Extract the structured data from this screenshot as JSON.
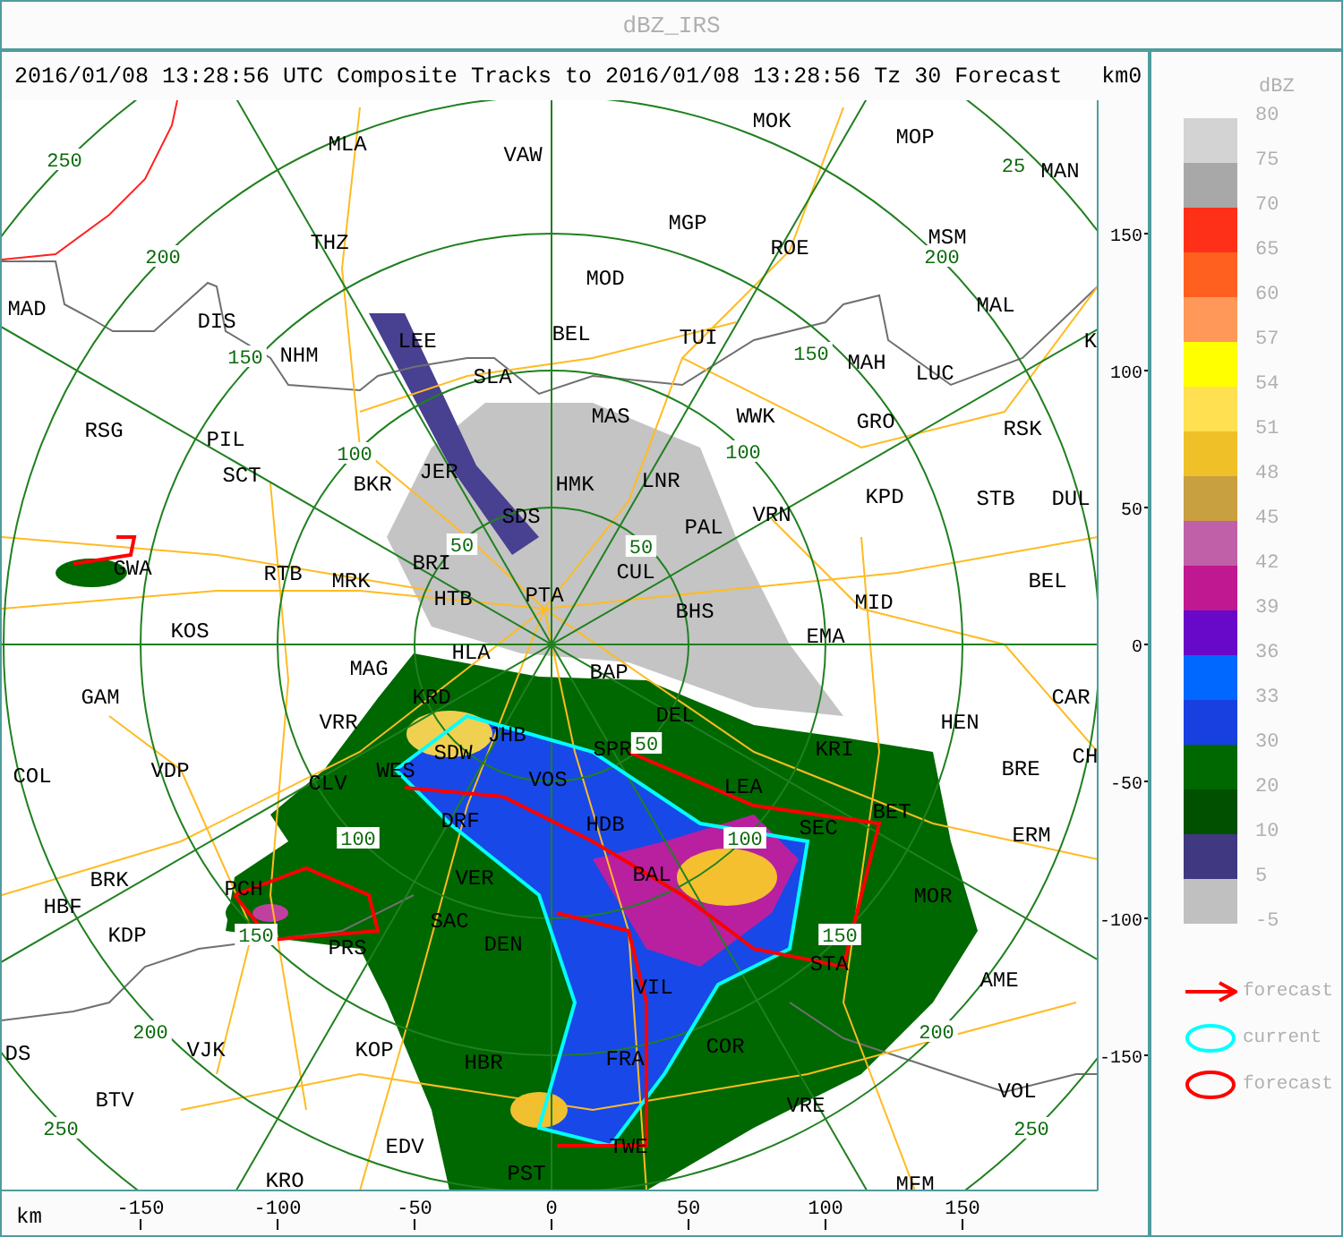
{
  "window": {
    "title": "dBZ_IRS"
  },
  "header": {
    "text": "2016/01/08 13:28:56 UTC Composite Tracks to 2016/01/08 13:28:56 Tz 30 Forecast",
    "corner": "km0"
  },
  "map": {
    "stations": [
      "MOK",
      "MLA",
      "MOP",
      "VAW",
      "MAN",
      "MGP",
      "THZ",
      "ROE",
      "MSM",
      "MOD",
      "MAD",
      "DIS",
      "MAL",
      "NHM",
      "LEE",
      "BEL",
      "TUI",
      "K",
      "SLA",
      "MAH",
      "LUC",
      "RSG",
      "PIL",
      "MAS",
      "WWK",
      "GRO",
      "RSK",
      "SCT",
      "BKR",
      "JER",
      "HMK",
      "LNR",
      "KPD",
      "STB",
      "DUL",
      "SDS",
      "PAL",
      "VRN",
      "GWA",
      "RTB",
      "MRK",
      "BRI",
      "CUL",
      "BEL",
      "HTB",
      "PTA",
      "BHS",
      "MID",
      "KOS",
      "EMA",
      "HLA",
      "MAG",
      "BAP",
      "GAM",
      "KRD",
      "CAR",
      "VRR",
      "DEL",
      "HEN",
      "JHB",
      "SDW",
      "SPR",
      "KRI",
      "CH",
      "COL",
      "VDP",
      "CLV",
      "WES",
      "VOS",
      "LEA",
      "BRE",
      "DRF",
      "HDB",
      "SEC",
      "BET",
      "ERM",
      "BRK",
      "PCH",
      "VER",
      "BAL",
      "MOR",
      "HBF",
      "SAC",
      "KDP",
      "PRS",
      "DEN",
      "STA",
      "VIL",
      "AME",
      "DS",
      "VJK",
      "KOP",
      "HBR",
      "FRA",
      "COR",
      "BTV",
      "VRE",
      "VOL",
      "EDV",
      "TWE",
      "KRO",
      "PST",
      "MFM"
    ],
    "range_labels": [
      "250",
      "200",
      "150",
      "100",
      "50",
      "50",
      "100",
      "150",
      "200",
      "25",
      "100",
      "150",
      "200",
      "250",
      "50",
      "100",
      "150",
      "200",
      "250"
    ],
    "x_axis": {
      "unit": "km",
      "ticks": [
        "-150",
        "-100",
        "-50",
        "0",
        "50",
        "100",
        "150"
      ]
    },
    "y_axis": {
      "ticks": [
        "150",
        "100",
        "50",
        "0",
        "-50",
        "-100",
        "-150"
      ]
    }
  },
  "scale": {
    "title": "dBZ",
    "bins": [
      {
        "label": "80",
        "color": "#d3d3d3"
      },
      {
        "label": "75",
        "color": "#a8a8a8"
      },
      {
        "label": "70",
        "color": "#ff3018"
      },
      {
        "label": "65",
        "color": "#ff6020"
      },
      {
        "label": "60",
        "color": "#ff9858"
      },
      {
        "label": "57",
        "color": "#ffff00"
      },
      {
        "label": "54",
        "color": "#ffe050"
      },
      {
        "label": "51",
        "color": "#f0c028"
      },
      {
        "label": "48",
        "color": "#c8a040"
      },
      {
        "label": "45",
        "color": "#c060a8"
      },
      {
        "label": "42",
        "color": "#c01890"
      },
      {
        "label": "39",
        "color": "#6808c8"
      },
      {
        "label": "36",
        "color": "#0068ff"
      },
      {
        "label": "33",
        "color": "#1840e0"
      },
      {
        "label": "30",
        "color": "#006800"
      },
      {
        "label": "20",
        "color": "#005000"
      },
      {
        "label": "10",
        "color": "#403880"
      },
      {
        "label": "5",
        "color": "#c0c0c0"
      }
    ],
    "bottom_label": "-5"
  },
  "legend": [
    {
      "kind": "arrow",
      "label": "forecast",
      "color": "#ff0000"
    },
    {
      "kind": "ellipse",
      "label": "current",
      "color": "#00ffff"
    },
    {
      "kind": "ellipse",
      "label": "forecast",
      "color": "#ff0000"
    }
  ]
}
